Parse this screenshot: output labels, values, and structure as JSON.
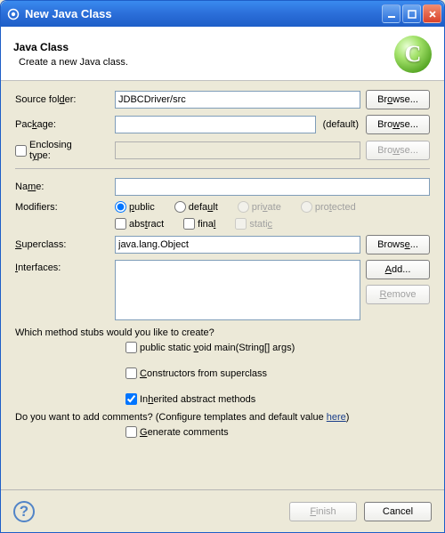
{
  "window": {
    "title": "New Java Class"
  },
  "header": {
    "title": "Java Class",
    "subtitle": "Create a new Java class.",
    "iconLetter": "C"
  },
  "labels": {
    "sourceFolder": "Source folder:",
    "package": "Package:",
    "enclosingType": "Enclosing type:",
    "name": "Name:",
    "modifiers": "Modifiers:",
    "superclass": "Superclass:",
    "interfaces": "Interfaces:"
  },
  "fields": {
    "sourceFolder": "JDBCDriver/src",
    "package": "",
    "packageDefault": "(default)",
    "enclosingType": "",
    "name": "",
    "superclass": "java.lang.Object"
  },
  "modifiers": {
    "access": {
      "public": "public",
      "default": "default",
      "private": "private",
      "protected": "protected",
      "selected": "public"
    },
    "abstract": "abstract",
    "final": "final",
    "static": "static"
  },
  "buttons": {
    "browse": "Browse...",
    "add": "Add...",
    "remove": "Remove",
    "finish": "Finish",
    "cancel": "Cancel"
  },
  "stubs": {
    "question": "Which method stubs would you like to create?",
    "main": "public static void main(String[] args)",
    "constructors": "Constructors from superclass",
    "inherited": "Inherited abstract methods"
  },
  "comments": {
    "question_pre": "Do you want to add comments? (Configure templates and default value ",
    "here": "here",
    "question_post": ")",
    "generate": "Generate comments"
  }
}
